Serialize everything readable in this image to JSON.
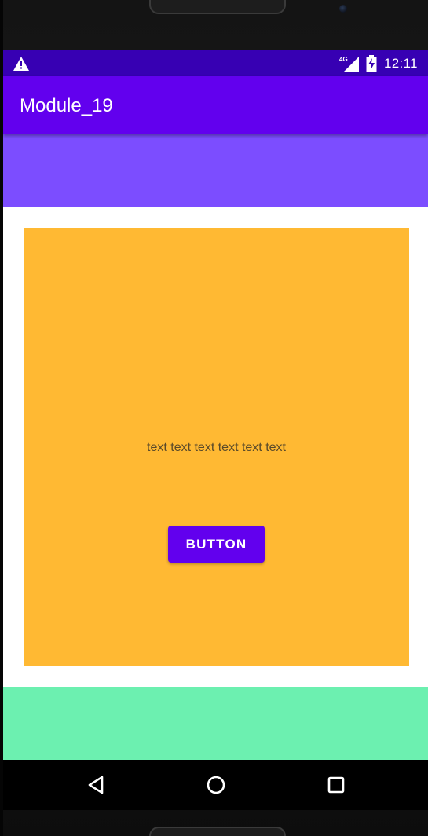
{
  "status_bar": {
    "network_label": "4G",
    "time": "12:11",
    "background_color": "#3700b3",
    "icons": [
      "warning-icon",
      "signal-icon",
      "battery-charging-icon"
    ]
  },
  "app_bar": {
    "title": "Module_19",
    "background_color": "#6200ee"
  },
  "top_block": {
    "color": "#7c4dff"
  },
  "card": {
    "background_color": "#ffb933",
    "text": "text text text text text text",
    "button_label": "BUTTON",
    "button_color": "#6200ee"
  },
  "bottom_block": {
    "color": "#6cf0b0"
  },
  "nav_bar": {
    "buttons": [
      "back-icon",
      "home-icon",
      "recents-icon"
    ]
  }
}
